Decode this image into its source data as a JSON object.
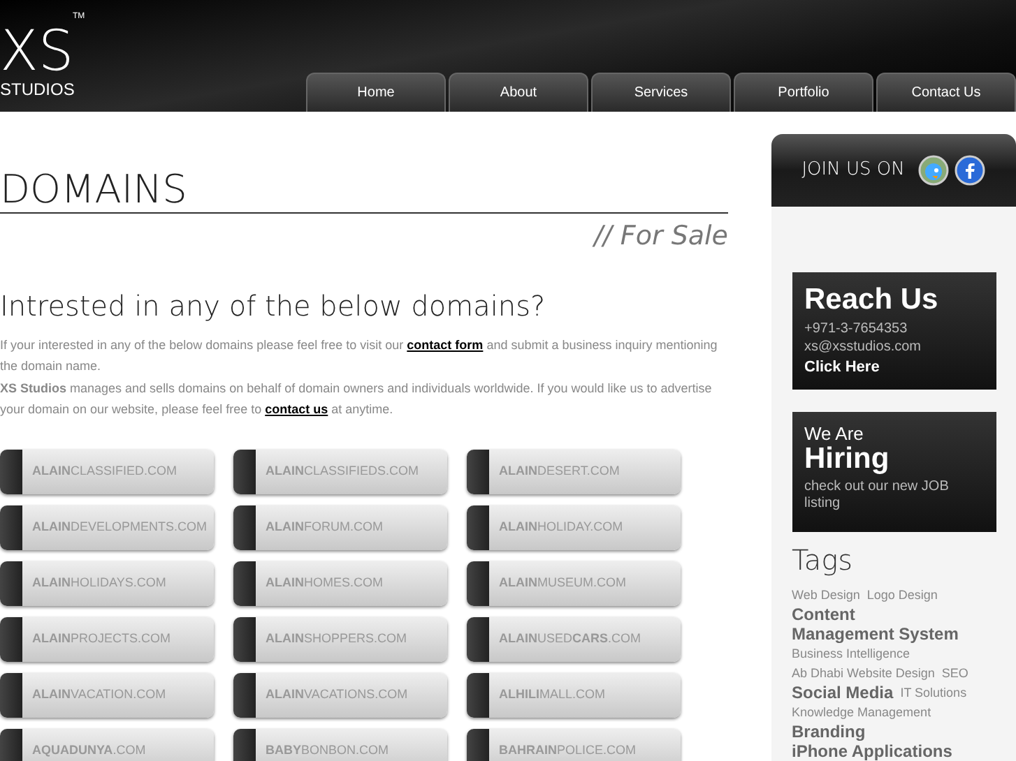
{
  "logo": {
    "main": "XS",
    "sub": "STUDIOS",
    "tm": "TM"
  },
  "nav": [
    {
      "label": "Home"
    },
    {
      "label": "About"
    },
    {
      "label": "Services"
    },
    {
      "label": "Portfolio"
    },
    {
      "label": "Contact Us"
    }
  ],
  "page_title": "DOMAINS",
  "page_subtitle": "// For Sale",
  "heading": "Intrested in any of the below domains?",
  "paragraphs": [
    {
      "before": "If your interested in any of the below domains please feel free to visit our ",
      "link": "contact form",
      "after": " and submit a business  inquiry mentioning the domain name."
    },
    {
      "before": "**XS Studios** manages and sells domains on behalf of domain owners and individuals worldwide. If you would like us to advertise your domain on our website, please feel free to ",
      "link": "contact us",
      "after": " at anytime."
    }
  ],
  "domains": [
    "**ALAIN**CLASSIFIED.COM",
    "**ALAIN**CLASSIFIEDS.COM",
    "**ALAIN**DESERT.COM",
    "**ALAIN**DEVELOPMENTS.COM",
    "**ALAIN**FORUM.COM",
    "**ALAIN**HOLIDAY.COM",
    "**ALAIN**HOLIDAYS.COM",
    "**ALAIN**HOMES.COM",
    "**ALAIN**MUSEUM.COM",
    "**ALAIN**PROJECTS.COM",
    "**ALAIN**SHOPPERS.COM",
    "**ALAIN**USED**CARS**.COM",
    "**ALAIN**VACATION.COM",
    "**ALAIN**VACATIONS.COM",
    "**ALHILI**MALL.COM",
    "**AQUADUNYA**.COM",
    "**BABY**BONBON.COM",
    "**BAHRAIN**POLICE.COM"
  ],
  "join": {
    "label": "JOIN US ON"
  },
  "reach": {
    "title": "Reach Us",
    "phone": "+971-3-7654353",
    "email": "xs@xsstudios.com",
    "link": "Click Here"
  },
  "hiring": {
    "pre": "We Are",
    "title": "Hiring",
    "text": "check out our new JOB listing"
  },
  "tags": {
    "title": "Tags",
    "items": [
      {
        "label": "Web Design",
        "kind": "small"
      },
      {
        "label": "Logo Design",
        "kind": "small"
      },
      {
        "label": "Content Management System",
        "kind": "large"
      },
      {
        "label": "Business Intelligence",
        "kind": "small"
      },
      {
        "label": "Ab Dhabi Website Design",
        "kind": "small"
      },
      {
        "label": "SEO",
        "kind": "small"
      },
      {
        "label": "Social Media",
        "kind": "large"
      },
      {
        "label": "IT Solutions",
        "kind": "small"
      },
      {
        "label": "Knowledge Management",
        "kind": "small"
      },
      {
        "label": "Branding",
        "kind": "large"
      },
      {
        "label": "iPhone Applications",
        "kind": "large"
      }
    ]
  }
}
